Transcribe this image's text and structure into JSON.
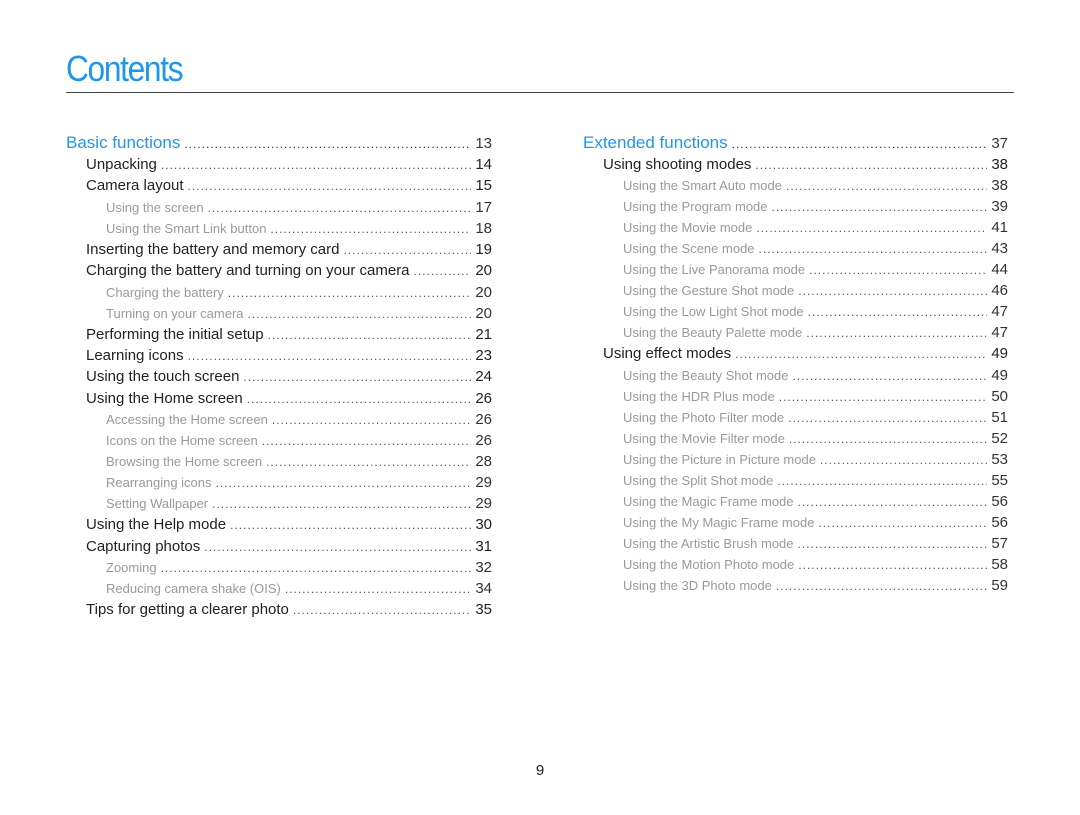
{
  "title": "Contents",
  "page_number": "9",
  "left": [
    {
      "level": 0,
      "label": "Basic functions",
      "page": "13"
    },
    {
      "level": 1,
      "label": "Unpacking",
      "page": "14"
    },
    {
      "level": 1,
      "label": "Camera layout",
      "page": "15"
    },
    {
      "level": 2,
      "label": "Using the screen",
      "page": "17"
    },
    {
      "level": 2,
      "label": "Using the Smart Link button",
      "page": "18"
    },
    {
      "level": 1,
      "label": "Inserting the battery and memory card",
      "page": "19"
    },
    {
      "level": 1,
      "label": "Charging the battery and turning on your camera",
      "page": "20"
    },
    {
      "level": 2,
      "label": "Charging the battery",
      "page": "20"
    },
    {
      "level": 2,
      "label": "Turning on your camera",
      "page": "20"
    },
    {
      "level": 1,
      "label": "Performing the initial setup",
      "page": "21"
    },
    {
      "level": 1,
      "label": "Learning icons",
      "page": "23"
    },
    {
      "level": 1,
      "label": "Using the touch screen",
      "page": "24"
    },
    {
      "level": 1,
      "label": "Using the Home screen",
      "page": "26"
    },
    {
      "level": 2,
      "label": "Accessing the Home screen",
      "page": "26"
    },
    {
      "level": 2,
      "label": "Icons on the Home screen",
      "page": "26"
    },
    {
      "level": 2,
      "label": "Browsing the Home screen",
      "page": "28"
    },
    {
      "level": 2,
      "label": "Rearranging icons",
      "page": "29"
    },
    {
      "level": 2,
      "label": "Setting Wallpaper",
      "page": "29"
    },
    {
      "level": 1,
      "label": "Using the Help mode",
      "page": "30"
    },
    {
      "level": 1,
      "label": "Capturing photos",
      "page": "31"
    },
    {
      "level": 2,
      "label": "Zooming",
      "page": "32"
    },
    {
      "level": 2,
      "label": "Reducing camera shake (OIS)",
      "page": "34"
    },
    {
      "level": 1,
      "label": "Tips for getting a clearer photo",
      "page": "35"
    }
  ],
  "right": [
    {
      "level": 0,
      "label": "Extended functions",
      "page": "37"
    },
    {
      "level": 1,
      "label": "Using shooting modes",
      "page": "38"
    },
    {
      "level": 2,
      "label": "Using the Smart Auto mode",
      "page": "38"
    },
    {
      "level": 2,
      "label": "Using the Program mode",
      "page": "39"
    },
    {
      "level": 2,
      "label": "Using the Movie mode",
      "page": "41"
    },
    {
      "level": 2,
      "label": "Using the Scene mode",
      "page": "43"
    },
    {
      "level": 2,
      "label": "Using the Live Panorama mode",
      "page": "44"
    },
    {
      "level": 2,
      "label": "Using the Gesture Shot mode",
      "page": "46"
    },
    {
      "level": 2,
      "label": "Using the Low Light Shot mode",
      "page": "47"
    },
    {
      "level": 2,
      "label": "Using the Beauty Palette mode",
      "page": "47"
    },
    {
      "level": 1,
      "label": "Using effect modes",
      "page": "49"
    },
    {
      "level": 2,
      "label": "Using the Beauty Shot mode",
      "page": "49"
    },
    {
      "level": 2,
      "label": "Using the HDR Plus mode",
      "page": "50"
    },
    {
      "level": 2,
      "label": "Using the Photo Filter mode",
      "page": "51"
    },
    {
      "level": 2,
      "label": "Using the Movie Filter mode",
      "page": "52"
    },
    {
      "level": 2,
      "label": "Using the Picture in Picture mode",
      "page": "53"
    },
    {
      "level": 2,
      "label": "Using the Split Shot mode",
      "page": "55"
    },
    {
      "level": 2,
      "label": "Using the Magic Frame mode",
      "page": "56"
    },
    {
      "level": 2,
      "label": "Using the My Magic Frame mode",
      "page": "56"
    },
    {
      "level": 2,
      "label": "Using the Artistic Brush mode",
      "page": "57"
    },
    {
      "level": 2,
      "label": "Using the Motion Photo mode",
      "page": "58"
    },
    {
      "level": 2,
      "label": "Using the 3D Photo mode",
      "page": "59"
    }
  ]
}
